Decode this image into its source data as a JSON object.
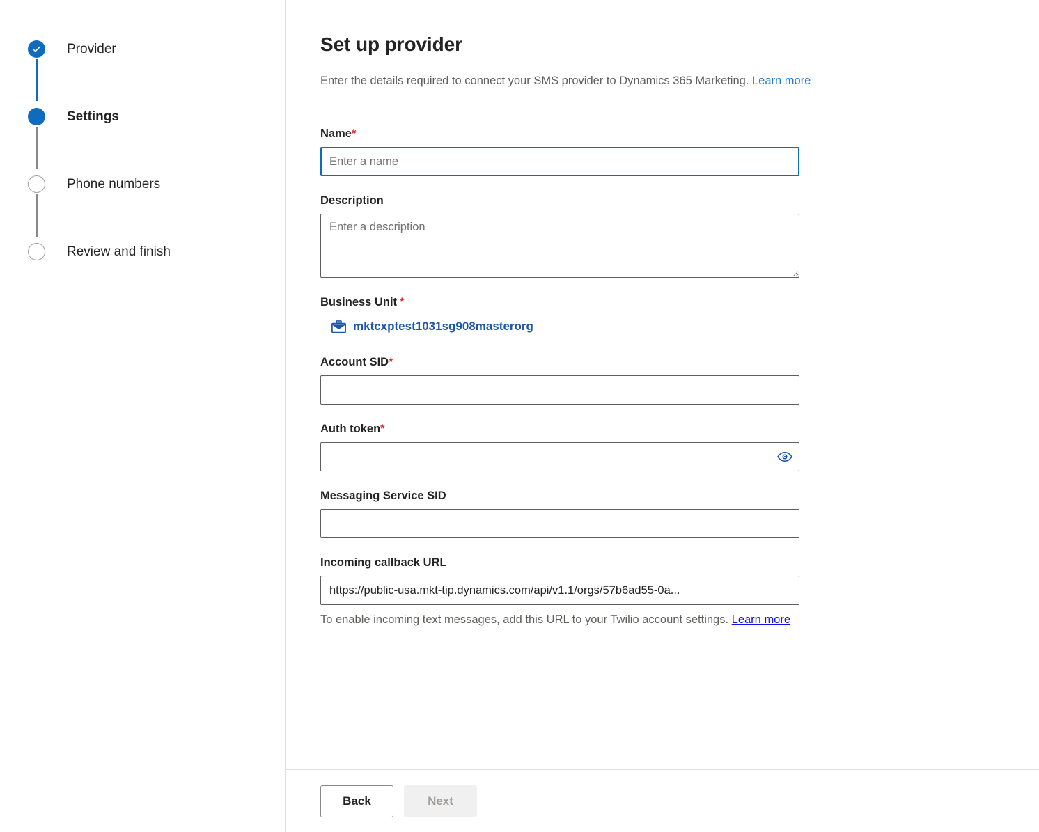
{
  "stepper": {
    "steps": [
      {
        "label": "Provider",
        "state": "done",
        "icon": "check-circle-icon"
      },
      {
        "label": "Settings",
        "state": "current",
        "icon": "filled-circle-icon"
      },
      {
        "label": "Phone numbers",
        "state": "pending",
        "icon": "empty-circle-icon"
      },
      {
        "label": "Review and finish",
        "state": "pending",
        "icon": "empty-circle-icon"
      }
    ],
    "active_index": 1
  },
  "header": {
    "title": "Set up provider",
    "subtitle": "Enter the details required to connect your SMS provider to Dynamics 365 Marketing.",
    "learn_more_label": "Learn more"
  },
  "form": {
    "name": {
      "label": "Name",
      "required_marker": "*",
      "placeholder": "Enter a name",
      "value": ""
    },
    "description": {
      "label": "Description",
      "placeholder": "Enter a description",
      "value": ""
    },
    "business_unit": {
      "label": "Business Unit",
      "required_marker": "*",
      "value": "mktcxptest1031sg908masterorg",
      "icon": "briefcase-icon"
    },
    "account_sid": {
      "label": "Account SID",
      "required_marker": "*",
      "placeholder": "",
      "value": ""
    },
    "auth_token": {
      "label": "Auth token",
      "required_marker": "*",
      "placeholder": "",
      "value": "",
      "reveal_icon": "eye-icon"
    },
    "messaging_service_sid": {
      "label": "Messaging Service SID",
      "placeholder": "",
      "value": ""
    },
    "incoming_callback_url": {
      "label": "Incoming callback URL",
      "value": "https://public-usa.mkt-tip.dynamics.com/api/v1.1/orgs/57b6ad55-0a...",
      "helper_text": "To enable incoming text messages, add this URL to your Twilio account settings.",
      "helper_link_label": "Learn more"
    }
  },
  "footer": {
    "back_label": "Back",
    "next_label": "Next",
    "next_disabled": true
  },
  "colors": {
    "accent": "#0f6cbd",
    "required": "#d13438",
    "link": "#2a7ad2",
    "link_underlined": "#1414e0",
    "lookup_value": "#1f56a5",
    "text_primary": "#242424",
    "text_secondary": "#605e5c",
    "border": "#605e5c",
    "divider": "#e1dfdd",
    "disabled_bg": "#f0f0f0",
    "disabled_fg": "#a19f9d"
  }
}
